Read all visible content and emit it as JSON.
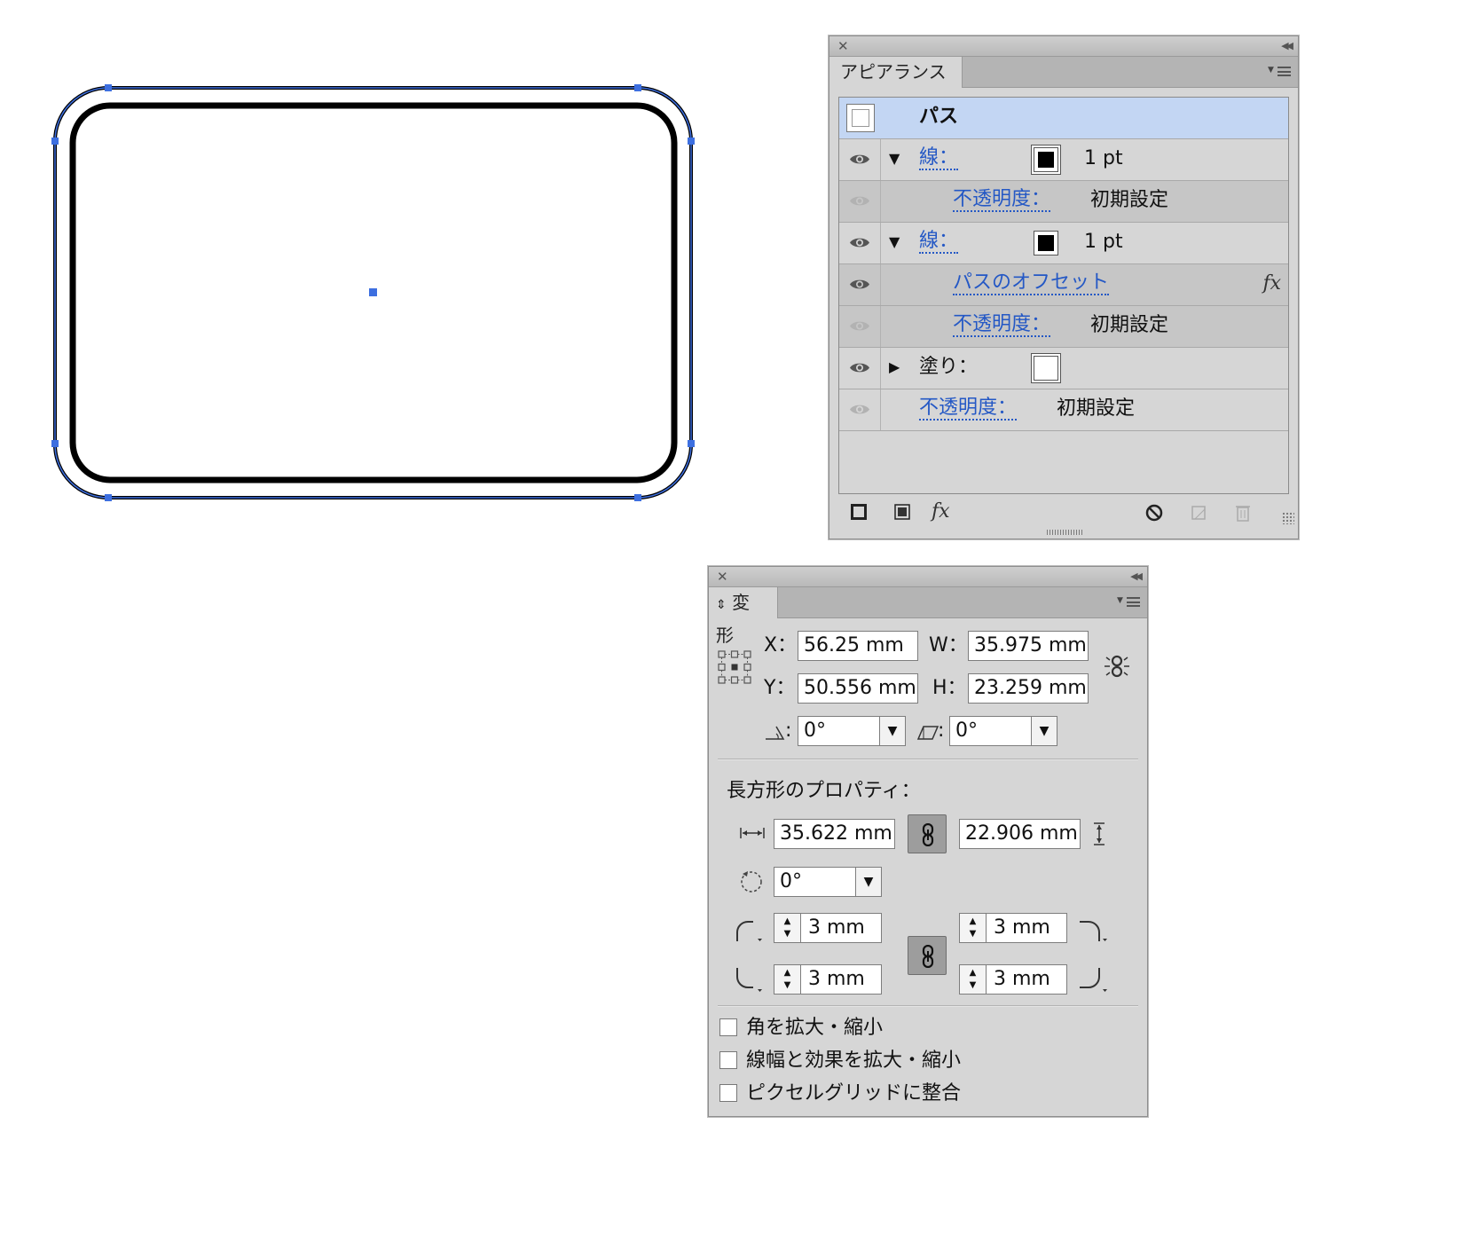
{
  "colors": {
    "selection_blue": "#3d6fe0",
    "link_blue": "#2458c5",
    "selected_row": "#c3d6f3",
    "panel_bg": "#d6d6d6"
  },
  "appearance": {
    "tab_label": "アピアランス",
    "rows": [
      {
        "label": "パス"
      },
      {
        "label": "線：",
        "value": "1 pt"
      },
      {
        "label": "不透明度：",
        "value": "初期設定"
      },
      {
        "label": "線：",
        "value": "1 pt"
      },
      {
        "label": "パスのオフセット",
        "fx": "fx"
      },
      {
        "label": "不透明度：",
        "value": "初期設定"
      },
      {
        "label": "塗り："
      },
      {
        "label": "不透明度：",
        "value": "初期設定"
      }
    ],
    "footer_fx": "fx"
  },
  "transform": {
    "tab_label": "変形",
    "x_label": "X：",
    "x_value": "56.25 mm",
    "y_label": "Y：",
    "y_value": "50.556 mm",
    "w_label": "W：",
    "w_value": "35.975 mm",
    "h_label": "H：",
    "h_value": "23.259 mm",
    "rotate_label": ":",
    "rotate_value": "0°",
    "shear_label": ":",
    "shear_value": "0°",
    "rect_props_label": "長方形のプロパティ：",
    "rect_width": "35.622 mm",
    "rect_height": "22.906 mm",
    "rect_rotate": "0°",
    "corner_tl": "3 mm",
    "corner_tr": "3 mm",
    "corner_bl": "3 mm",
    "corner_br": "3 mm",
    "checkbox_scale_corners": "角を拡大・縮小",
    "checkbox_scale_strokes": "線幅と効果を拡大・縮小",
    "checkbox_align_pixel": "ピクセルグリッドに整合"
  }
}
